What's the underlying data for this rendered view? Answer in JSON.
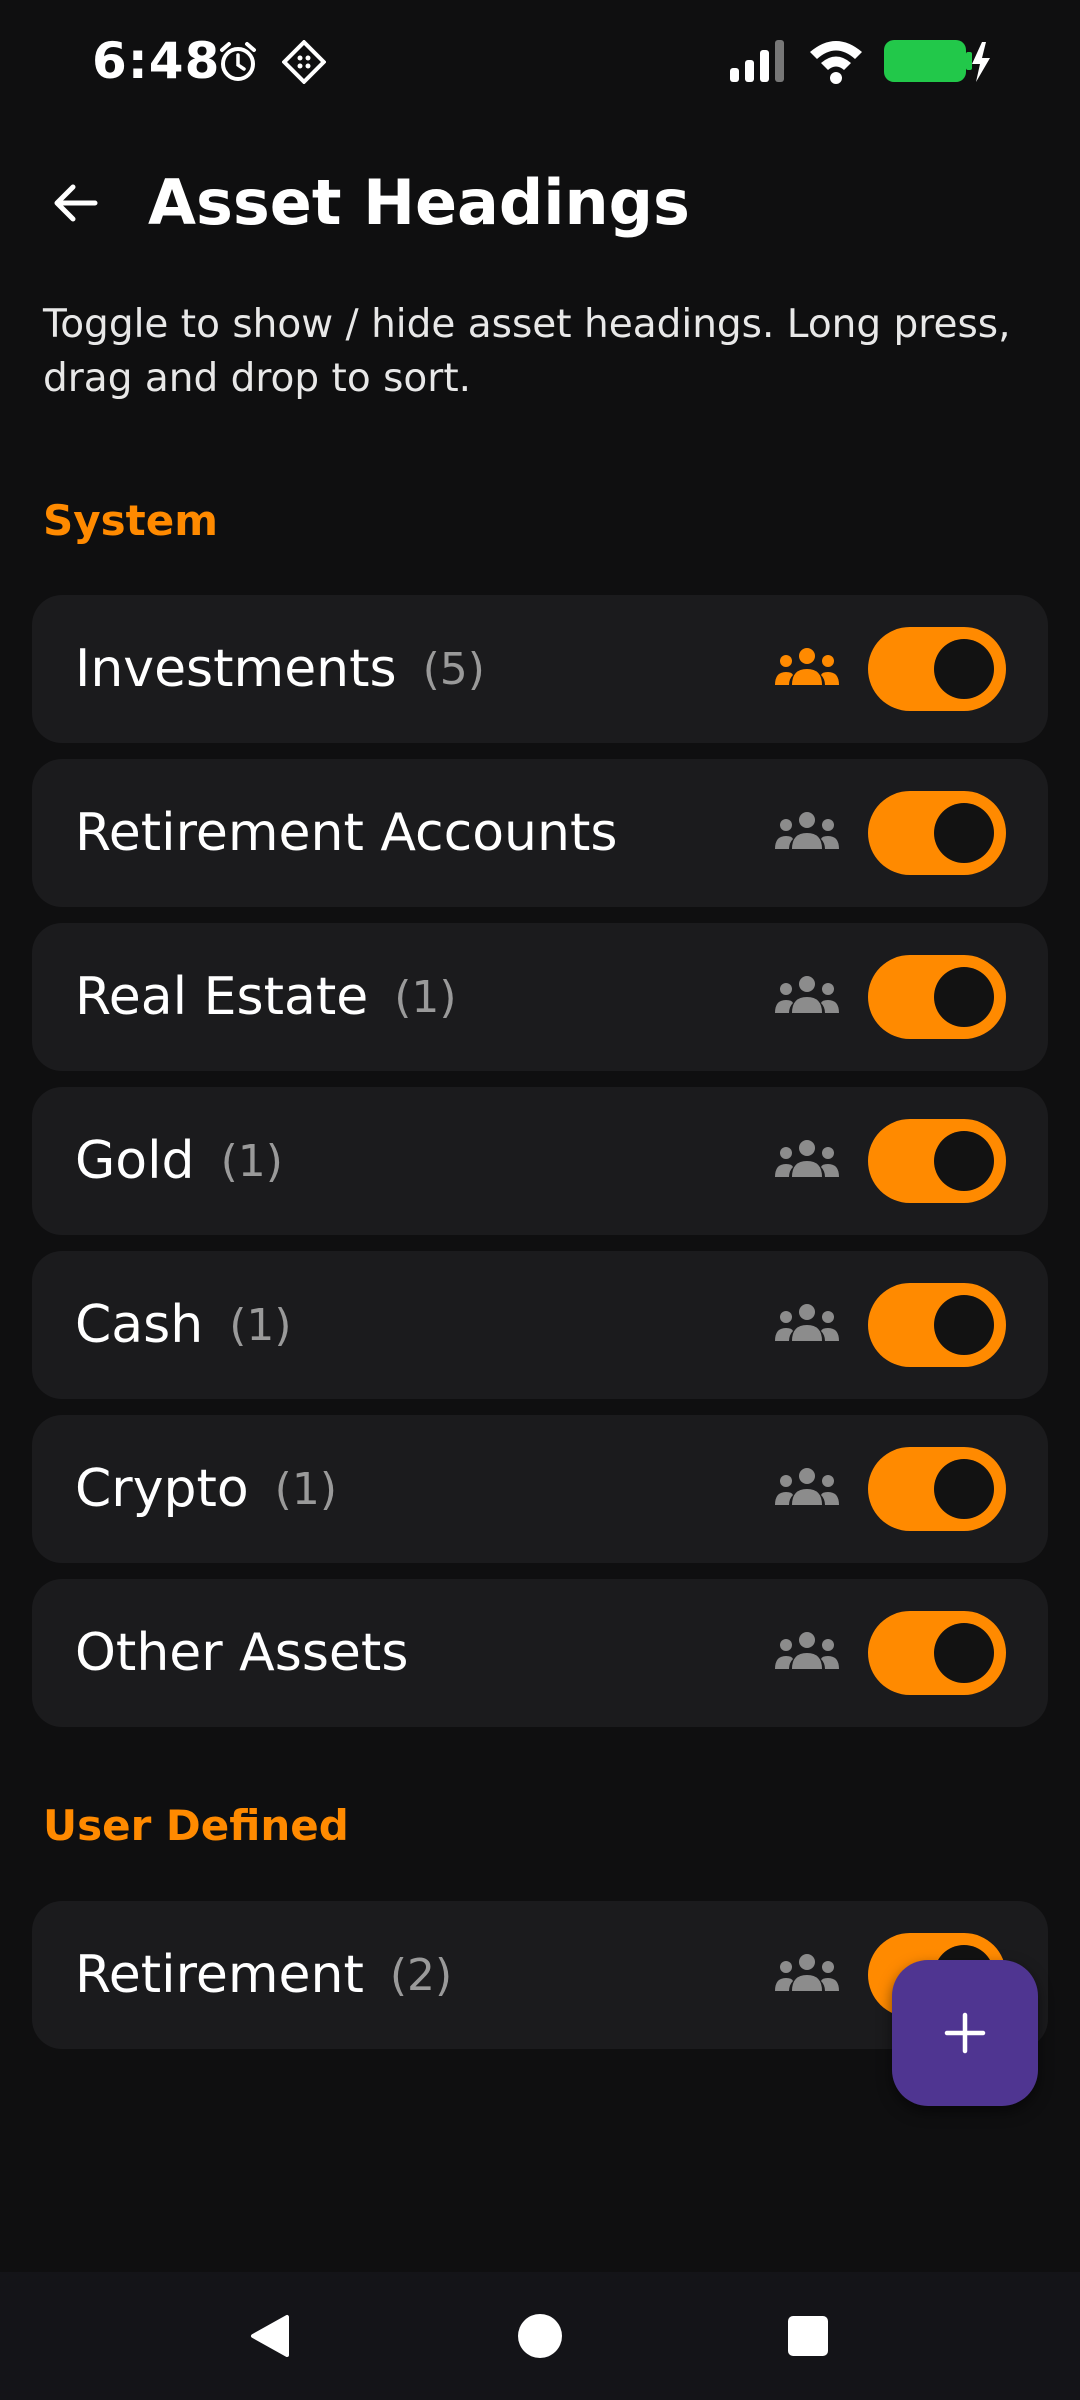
{
  "status_bar": {
    "time": "6:48",
    "icons": [
      "alarm-icon",
      "app-notification-icon",
      "signal-icon",
      "wifi-icon",
      "battery-charging-icon"
    ],
    "battery_color": "#22c84a"
  },
  "header": {
    "back_icon": "arrow-left-icon",
    "title": "Asset Headings"
  },
  "description": "Toggle to show / hide asset headings. Long press, drag and drop to sort.",
  "sections": [
    {
      "label": "System",
      "items": [
        {
          "label": "Investments",
          "count": "(5)",
          "shared_active": true,
          "enabled": true
        },
        {
          "label": "Retirement Accounts",
          "count": "",
          "shared_active": false,
          "enabled": true
        },
        {
          "label": "Real Estate",
          "count": "(1)",
          "shared_active": false,
          "enabled": true
        },
        {
          "label": "Gold",
          "count": "(1)",
          "shared_active": false,
          "enabled": true
        },
        {
          "label": "Cash",
          "count": "(1)",
          "shared_active": false,
          "enabled": true
        },
        {
          "label": "Crypto",
          "count": "(1)",
          "shared_active": false,
          "enabled": true
        },
        {
          "label": "Other Assets",
          "count": "",
          "shared_active": false,
          "enabled": true
        }
      ]
    },
    {
      "label": "User Defined",
      "items": [
        {
          "label": "Retirement",
          "count": "(2)",
          "shared_active": false,
          "enabled": true
        }
      ]
    }
  ],
  "fab": {
    "icon": "plus-icon"
  },
  "nav": {
    "icons": [
      "back-triangle-icon",
      "home-circle-icon",
      "recents-square-icon"
    ]
  },
  "colors": {
    "accent": "#ff8a00",
    "background": "#0f0f10",
    "card": "#1b1b1d",
    "fab": "#4f3591",
    "share_inactive": "#8c8c8c"
  }
}
